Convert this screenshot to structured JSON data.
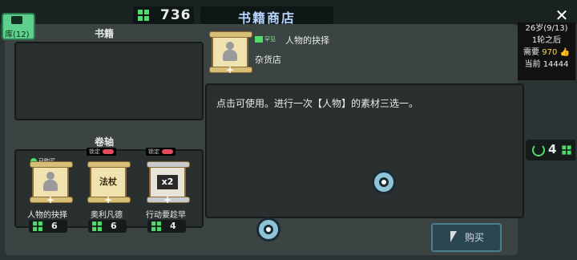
{
  "header": {
    "currency_value": "736",
    "title": "书籍商店",
    "close_label": "✕"
  },
  "library": {
    "label": "库(12)"
  },
  "info": {
    "age": "26岁(9/13)",
    "rounds_later": "1轮之后",
    "need_label": "需要",
    "need_value": "970",
    "current_label": "当前",
    "current_value": "14444"
  },
  "sections": {
    "books_title": "书籍",
    "scrolls_title": "卷轴"
  },
  "scrolls": [
    {
      "name": "人物的抉择",
      "price": "6",
      "badge": "已购买",
      "glyph": ""
    },
    {
      "name": "奥利凡德",
      "price": "6",
      "lock_label": "锁定",
      "glyph": "法杖"
    },
    {
      "name": "行动要趁早",
      "price": "4",
      "lock_label": "锁定",
      "glyph": "x2"
    }
  ],
  "detail": {
    "rarity": "罕见",
    "name": "人物的抉择",
    "source": "杂货店",
    "description": "点击可使用。进行一次【人物】的素材三选一。"
  },
  "refresh": {
    "value": "4"
  },
  "buy_button": {
    "label": "购买"
  },
  "colors": {
    "accent_green": "#4fdc6a",
    "title_blue": "#b7d4ff",
    "gold": "#ffd84a"
  }
}
